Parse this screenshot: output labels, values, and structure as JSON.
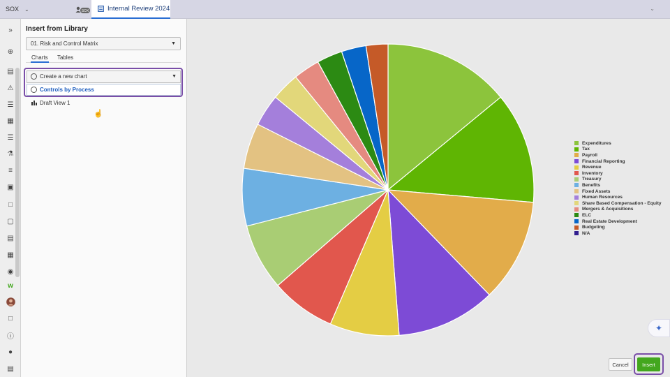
{
  "topbar": {
    "org_name": "SOX",
    "user_badge": "SOX",
    "active_tab": "Internal Review 2024"
  },
  "panel": {
    "title": "Insert from Library",
    "matrix_select": "01. Risk and Control Matrix",
    "tabs": [
      "Charts",
      "Tables"
    ],
    "chart_select": "Create a new chart",
    "highlighted_option": "Controls by Process",
    "draft_view": "Draft View 1"
  },
  "buttons": {
    "cancel": "Cancel",
    "insert": "Insert"
  },
  "chart_data": {
    "type": "pie",
    "categories": [
      "Expenditures",
      "Tax",
      "Payroll",
      "Financial Reporting",
      "Revenue",
      "Inventory",
      "Treasury",
      "Benefits",
      "Fixed Assets",
      "Human Resources",
      "Share Based Compensation - Equity",
      "Mergers & Acquisitions",
      "ELC",
      "Real Estate Development",
      "Budgeting",
      "N/A"
    ],
    "values": [
      13.9,
      12.2,
      11.3,
      10.9,
      7.6,
      7.1,
      7.3,
      6.3,
      5.0,
      3.5,
      3.1,
      2.9,
      2.8,
      2.7,
      2.4,
      0
    ],
    "colors": [
      "#8cc43c",
      "#5fb503",
      "#e2ac4a",
      "#7d4bd6",
      "#e4cd44",
      "#e1574d",
      "#a9cd74",
      "#6db0e2",
      "#e3c282",
      "#a47fdb",
      "#e2d77a",
      "#e58a80",
      "#2c8a13",
      "#0766c8",
      "#c55a28",
      "#321f8f"
    ],
    "legend_position": "right"
  }
}
